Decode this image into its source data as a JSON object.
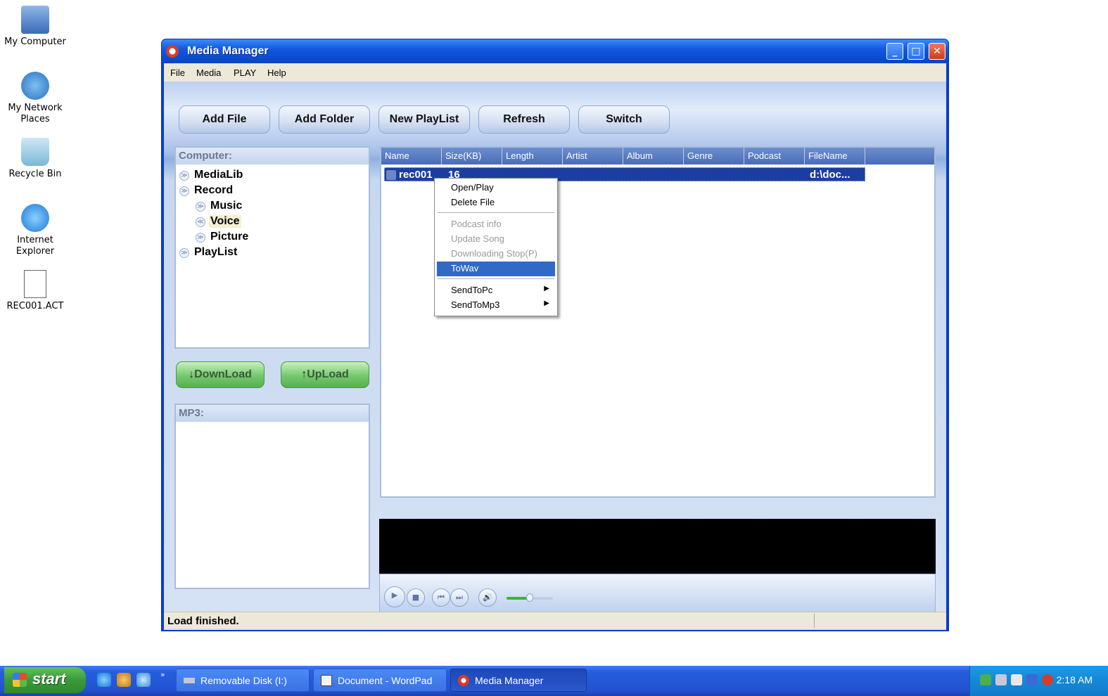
{
  "desktop": {
    "icons": [
      {
        "label": "My Computer"
      },
      {
        "label": "My Network Places"
      },
      {
        "label": "Recycle Bin"
      },
      {
        "label": "Internet Explorer"
      },
      {
        "label": "REC001.ACT"
      }
    ]
  },
  "window": {
    "title": "Media Manager",
    "menu": [
      "File",
      "Media",
      "PLAY",
      "Help"
    ],
    "toolbar": [
      "Add File",
      "Add Folder",
      "New PlayList",
      "Refresh",
      "Switch"
    ],
    "computer_panel": {
      "header": "Computer:",
      "tree": [
        "MediaLib",
        "Record",
        "Music",
        "Voice",
        "Picture",
        "PlayList"
      ]
    },
    "download_label": "DownLoad",
    "upload_label": "UpLoad",
    "mp3_panel": {
      "header": "MP3:"
    },
    "list": {
      "columns": [
        "Name",
        "Size(KB)",
        "Length",
        "Artist",
        "Album",
        "Genre",
        "Podcast",
        "FileName"
      ],
      "rows": [
        {
          "name": "rec001",
          "size": "16",
          "filename": "d:\\doc..."
        }
      ]
    },
    "context_menu": {
      "items": [
        "Open/Play",
        "Delete File",
        "Podcast info",
        "Update Song",
        "Downloading Stop(P)",
        "ToWav",
        "SendToPc",
        "SendToMp3"
      ]
    },
    "status": "Load finished."
  },
  "taskbar": {
    "start_label": "start",
    "tasks": [
      "Removable Disk (I:)",
      "Document - WordPad",
      "Media Manager"
    ],
    "clock": "2:18 AM"
  },
  "colors": {
    "titlebar": "#0b4bd0",
    "selection": "#1c3ea0",
    "menu_highlight": "#316ac5",
    "taskbar": "#245ee0"
  }
}
